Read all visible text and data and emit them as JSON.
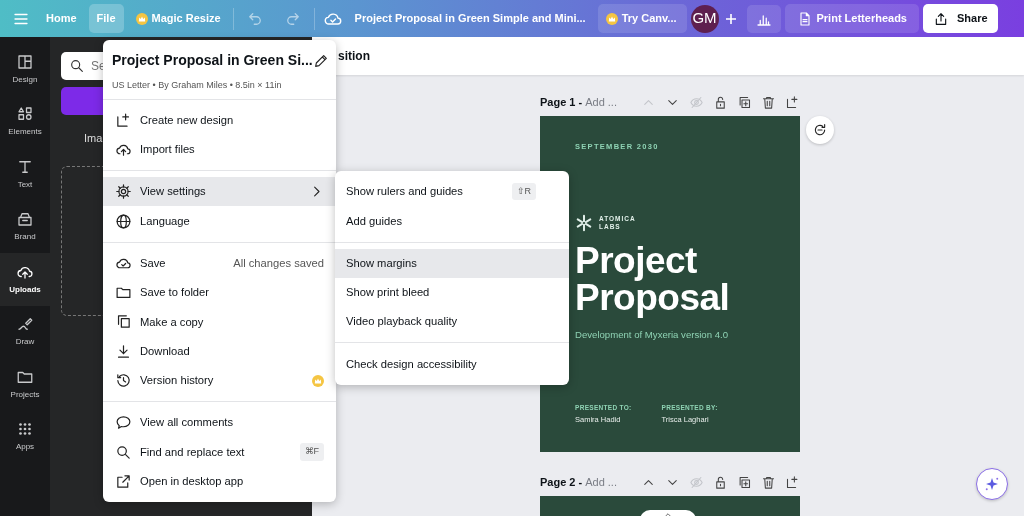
{
  "topbar": {
    "nav": [
      {
        "label": "Home",
        "selected": false,
        "premium": false
      },
      {
        "label": "File",
        "selected": true,
        "premium": false
      },
      {
        "label": "Magic Resize",
        "selected": false,
        "premium": true
      }
    ],
    "doc_title": "Project Proposal in Green Simple and Mini...",
    "trial": "Try Canv...",
    "avatar": "GM",
    "print": "Print Letterheads",
    "share": "Share"
  },
  "rail": [
    {
      "label": "Design",
      "kind": "design",
      "selected": false
    },
    {
      "label": "Elements",
      "kind": "elements",
      "selected": false
    },
    {
      "label": "Text",
      "kind": "text",
      "selected": false
    },
    {
      "label": "Brand",
      "kind": "brand",
      "selected": false
    },
    {
      "label": "Uploads",
      "kind": "upload",
      "selected": true
    },
    {
      "label": "Draw",
      "kind": "draw",
      "selected": false
    },
    {
      "label": "Projects",
      "kind": "folder",
      "selected": false
    },
    {
      "label": "Apps",
      "kind": "apps",
      "selected": false
    }
  ],
  "side_panel": {
    "search_placeholder": "Se",
    "tab": "Ima"
  },
  "toolbar": {
    "label": "sition"
  },
  "file_menu": {
    "title": "Project Proposal in Green Si...",
    "subtitle": "US Letter • By Graham Miles • 8.5in × 11in",
    "groups": [
      [
        {
          "kind": "plus",
          "label": "Create new design",
          "highlighted": false
        },
        {
          "kind": "upload",
          "label": "Import files",
          "highlighted": false
        }
      ],
      [
        {
          "kind": "gear",
          "label": "View settings",
          "highlighted": true,
          "submenu": true
        },
        {
          "kind": "globe",
          "label": "Language",
          "highlighted": false
        }
      ],
      [
        {
          "kind": "cloudcheck",
          "label": "Save",
          "hint": "All changes saved",
          "highlighted": false
        },
        {
          "kind": "folder",
          "label": "Save to folder",
          "highlighted": false
        },
        {
          "kind": "copy",
          "label": "Make a copy",
          "highlighted": false
        },
        {
          "kind": "download",
          "label": "Download",
          "highlighted": false
        },
        {
          "kind": "history",
          "label": "Version history",
          "highlighted": false,
          "premium": true
        }
      ],
      [
        {
          "kind": "comment",
          "label": "View all comments",
          "highlighted": false
        },
        {
          "kind": "search",
          "label": "Find and replace text",
          "shortcut": "⌘F",
          "highlighted": false
        },
        {
          "kind": "external",
          "label": "Open in desktop app",
          "highlighted": false
        }
      ]
    ]
  },
  "submenu": {
    "groups": [
      [
        {
          "label": "Show rulers and guides",
          "shortcut": "⇧R",
          "highlighted": false
        },
        {
          "label": "Add guides",
          "highlighted": false
        }
      ],
      [
        {
          "label": "Show margins",
          "highlighted": true
        },
        {
          "label": "Show print bleed",
          "highlighted": false
        },
        {
          "label": "Video playback quality",
          "highlighted": false
        }
      ],
      [
        {
          "label": "Check design accessibility",
          "highlighted": false
        }
      ]
    ]
  },
  "pages": [
    {
      "label": "Page 1 -",
      "title_placeholder": "Add ...",
      "up_disabled": true
    },
    {
      "label": "Page 2 -",
      "title_placeholder": "Add ...",
      "up_disabled": false
    }
  ],
  "document": {
    "date": "SEPTEMBER 2030",
    "logo_lines": [
      "ATOMICA",
      "LABS"
    ],
    "title_lines": [
      "Project",
      "Proposal"
    ],
    "subtitle": "Development of Myxeria version 4.0",
    "presented": [
      {
        "label": "PRESENTED TO:",
        "name": "Samira Hadid"
      },
      {
        "label": "PRESENTED BY:",
        "name": "Trisca Laghari"
      }
    ]
  }
}
